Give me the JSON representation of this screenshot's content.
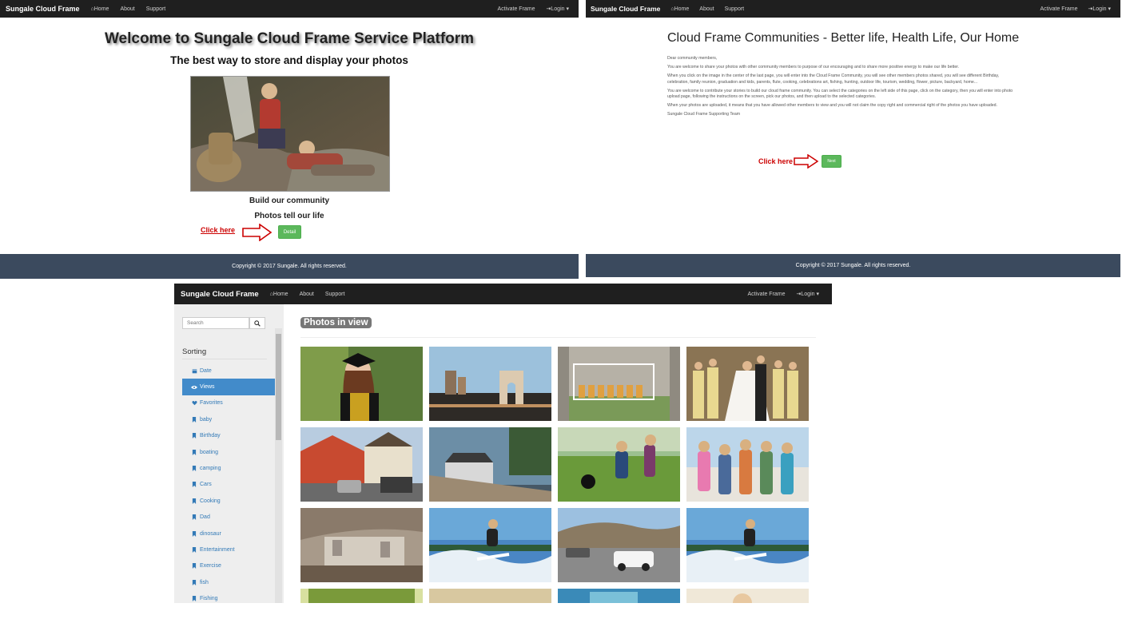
{
  "panel_a": {
    "nav": {
      "brand": "Sungale Cloud Frame",
      "home": "Home",
      "about": "About",
      "support": "Support",
      "activate": "Activate Frame",
      "login": "Login"
    },
    "title": "Welcome to Sungale Cloud Frame Service Platform",
    "subtitle": "The best way to store and display your photos",
    "line1": "Build our community",
    "line2": "Photos tell our life",
    "click_here": "Click here",
    "detail_button": "Detail",
    "footer": "Copyright © 2017 Sungale. All rights reserved."
  },
  "panel_b": {
    "nav": {
      "brand": "Sungale Cloud Frame",
      "home": "Home",
      "about": "About",
      "support": "Support",
      "activate": "Activate Frame",
      "login": "Login"
    },
    "title": "Cloud Frame Communities - Better life, Health Life, Our Home",
    "greeting": "Dear community members,",
    "paragraphs": [
      "You are welcome to share your photos with other community members to purpose of our encouraging and to share more positive energy to make our life better.",
      "When you click on the image in the center of the last page, you will enter into the Cloud Frame Community, you will see other members photos shared, you will see different Birthday, celebration, family reunion, graduation and kids, parents, flute, cooking, celebrations art, fishing, hunting, outdoor life, tourism, wedding, flower, picture, backyard, home...",
      "You are welcome to contribute your stories to build our cloud frame community. You can select the categories on the left side of this page, click on the category, then you will enter into photo upload page, following the instructions on the screen, pick our photos, and then upload to the selected categories.",
      "When your photos are uploaded, it means that you have allowed other members to view and you will not claim the copy right and commercial right of the photos you have uploaded."
    ],
    "signature": "Sungale Cloud Frame Supporting Team",
    "click_here": "Click here",
    "next_button": "Next",
    "footer": "Copyright © 2017 Sungale. All rights reserved."
  },
  "panel_c": {
    "nav": {
      "brand": "Sungale Cloud Frame",
      "home": "Home",
      "about": "About",
      "support": "Support",
      "activate": "Activate Frame",
      "login": "Login"
    },
    "search_placeholder": "Search",
    "sorting_label": "Sorting",
    "sort_items": [
      {
        "label": "Date",
        "icon": "calendar-icon"
      },
      {
        "label": "Views",
        "icon": "eye-icon",
        "active": true
      },
      {
        "label": "Favorites",
        "icon": "heart-icon"
      },
      {
        "label": "baby",
        "icon": "bookmark-icon"
      },
      {
        "label": "Birthday",
        "icon": "bookmark-icon"
      },
      {
        "label": "boating",
        "icon": "bookmark-icon"
      },
      {
        "label": "camping",
        "icon": "bookmark-icon"
      },
      {
        "label": "Cars",
        "icon": "bookmark-icon"
      },
      {
        "label": "Cooking",
        "icon": "bookmark-icon"
      },
      {
        "label": "Dad",
        "icon": "bookmark-icon"
      },
      {
        "label": "dinosaur",
        "icon": "bookmark-icon"
      },
      {
        "label": "Entertainment",
        "icon": "bookmark-icon"
      },
      {
        "label": "Exercise",
        "icon": "bookmark-icon"
      },
      {
        "label": "fish",
        "icon": "bookmark-icon"
      },
      {
        "label": "Fishing",
        "icon": "bookmark-icon"
      }
    ],
    "photos_header": "Photos in view"
  },
  "colors": {
    "navbar": "#1f1f1f",
    "footer": "#3b4a5e",
    "accent_green": "#5cb85c",
    "active_blue": "#428bca",
    "link_blue": "#337ab7",
    "click_red": "#cc0000"
  }
}
